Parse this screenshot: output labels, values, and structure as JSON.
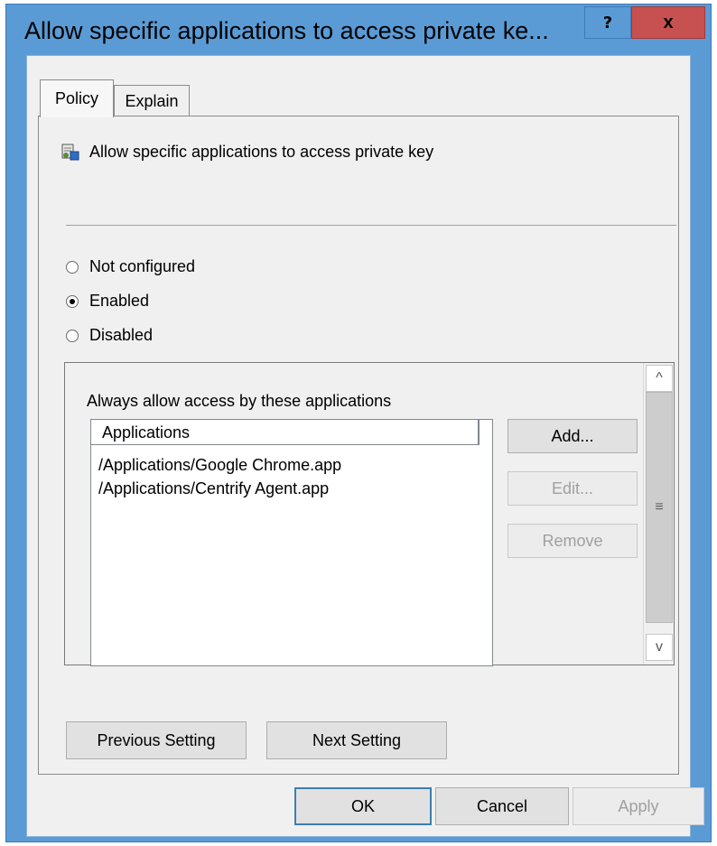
{
  "window": {
    "title": "Allow specific applications to access private ke...",
    "help_label": "?",
    "close_label": "x"
  },
  "tabs": [
    {
      "label": "Policy"
    },
    {
      "label": "Explain"
    }
  ],
  "policy": {
    "header": "Allow specific applications to access private key"
  },
  "radios": [
    {
      "label": "Not configured",
      "selected": false
    },
    {
      "label": "Enabled",
      "selected": true
    },
    {
      "label": "Disabled",
      "selected": false
    }
  ],
  "options": {
    "label": "Always allow access by these applications",
    "column_header": "Applications",
    "items": [
      "/Applications/Google Chrome.app",
      "/Applications/Centrify Agent.app"
    ],
    "add_label": "Add...",
    "edit_label": "Edit...",
    "remove_label": "Remove"
  },
  "scrollbar": {
    "up": "^",
    "down": "v",
    "grip": "≡"
  },
  "nav": {
    "previous_label": "Previous Setting",
    "next_label": "Next Setting"
  },
  "footer": {
    "ok_label": "OK",
    "cancel_label": "Cancel",
    "apply_label": "Apply"
  },
  "colors": {
    "titlebar": "#5b9bd5",
    "close": "#c75050",
    "client": "#f0f0f0"
  }
}
